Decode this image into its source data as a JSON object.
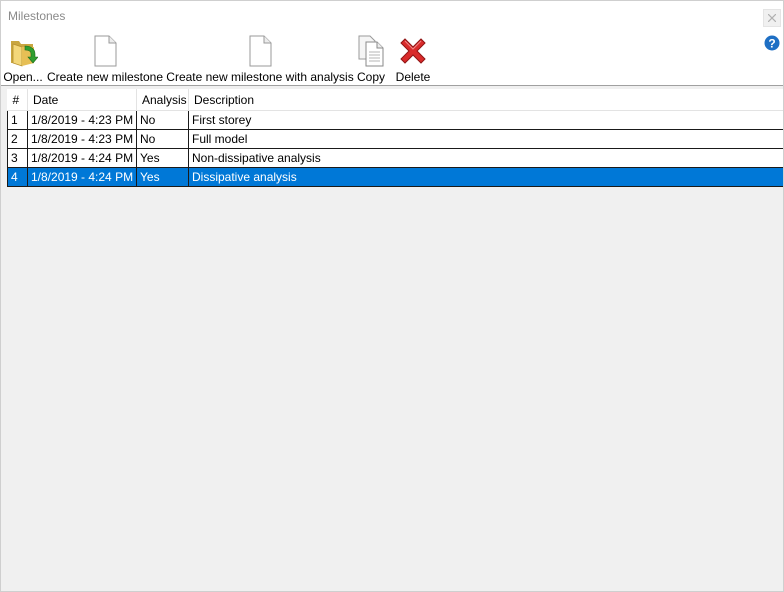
{
  "window": {
    "title": "Milestones"
  },
  "toolbar": {
    "open_label": "Open...",
    "create_label": "Create new milestone",
    "create_analysis_label": "Create new milestone with analysis",
    "copy_label": "Copy",
    "delete_label": "Delete"
  },
  "grid": {
    "columns": [
      "#",
      "Date",
      "Analysis",
      "Description"
    ],
    "rows": [
      {
        "num": "1",
        "date": "1/8/2019 - 4:23 PM",
        "analysis": "No",
        "description": "First storey"
      },
      {
        "num": "2",
        "date": "1/8/2019 - 4:23 PM",
        "analysis": "No",
        "description": "Full model"
      },
      {
        "num": "3",
        "date": "1/8/2019 - 4:24 PM",
        "analysis": "Yes",
        "description": "Non-dissipative analysis"
      },
      {
        "num": "4",
        "date": "1/8/2019 - 4:24 PM",
        "analysis": "Yes",
        "description": "Dissipative analysis"
      }
    ],
    "selected_row": "4"
  },
  "colors": {
    "selection": "#0078d7",
    "help": "#1e6fc4",
    "delete": "#d92b2b"
  },
  "icons": [
    "folder-open-icon",
    "new-document-icon",
    "copy-icon",
    "delete-x-icon",
    "help-icon",
    "close-icon"
  ]
}
